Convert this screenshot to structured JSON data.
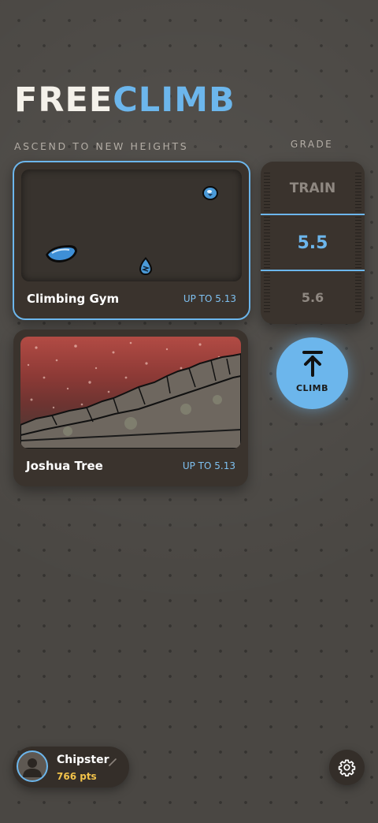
{
  "app": {
    "logo_part1": "FREE",
    "logo_part2": "CLIMB",
    "tagline": "ASCEND TO NEW HEIGHTS"
  },
  "grade": {
    "label": "GRADE",
    "options": [
      "TRAIN",
      "5.5",
      "5.6"
    ],
    "selected": "5.5"
  },
  "locations": [
    {
      "name": "Climbing Gym",
      "range": "UP TO 5.13",
      "selected": true
    },
    {
      "name": "Joshua Tree",
      "range": "UP TO 5.13",
      "selected": false
    }
  ],
  "climb_button": {
    "label": "CLIMB",
    "icon": "arrow-up-to-line-icon"
  },
  "profile": {
    "username": "Chipster",
    "points": "766 pts",
    "icon": "user-avatar-icon",
    "edit_icon": "pencil-icon"
  },
  "settings": {
    "icon": "gear-icon"
  },
  "colors": {
    "accent": "#6cb6ec",
    "points": "#f1c24a",
    "background": "#4a4743",
    "card": "#3a332d"
  }
}
